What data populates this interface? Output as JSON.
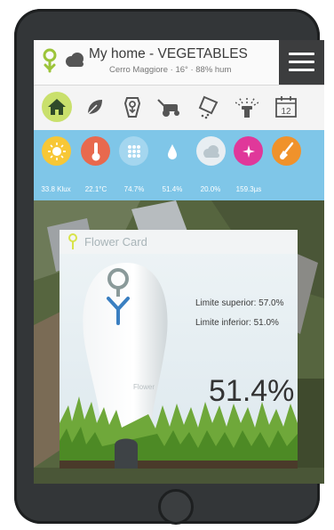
{
  "header": {
    "title": "My home - VEGETABLES",
    "subtitle": "Cerro Maggiore · 16° · 88% hum"
  },
  "toolbar": {
    "items": [
      {
        "icon": "home-icon"
      },
      {
        "icon": "leaf-icon"
      },
      {
        "icon": "plant-tag-icon"
      },
      {
        "icon": "lawn-mower-icon"
      },
      {
        "icon": "fertilizer-icon"
      },
      {
        "icon": "sprinkler-icon"
      },
      {
        "icon": "calendar-icon",
        "label": "12"
      }
    ]
  },
  "sensors": [
    {
      "icon": "sun-icon",
      "color": "#f7c736",
      "value": "33.8 Klux"
    },
    {
      "icon": "thermometer-icon",
      "color": "#e8694e",
      "value": "22.1°C"
    },
    {
      "icon": "humidity-icon",
      "color": "#a4d6ef",
      "value": "74.7%"
    },
    {
      "icon": "water-drop-icon",
      "color": "#7fc6e8",
      "value": "51.4%"
    },
    {
      "icon": "cloud-icon",
      "color": "#e8eef2",
      "value": "20.0%"
    },
    {
      "icon": "sparkle-icon",
      "color": "#e0389a",
      "value": "159.3µs"
    },
    {
      "icon": "shovel-icon",
      "color": "#f0922b",
      "value": ""
    }
  ],
  "card": {
    "title": "Flower Card",
    "limit_superior": "Limite superior: 57.0%",
    "limit_inferior": "Limite inferior: 51.0%",
    "value": "51.4%",
    "device_label": "Flower"
  },
  "colors": {
    "accent_green": "#c9e06c",
    "strip_blue": "#7fc6e8",
    "phone_frame": "#333638"
  }
}
